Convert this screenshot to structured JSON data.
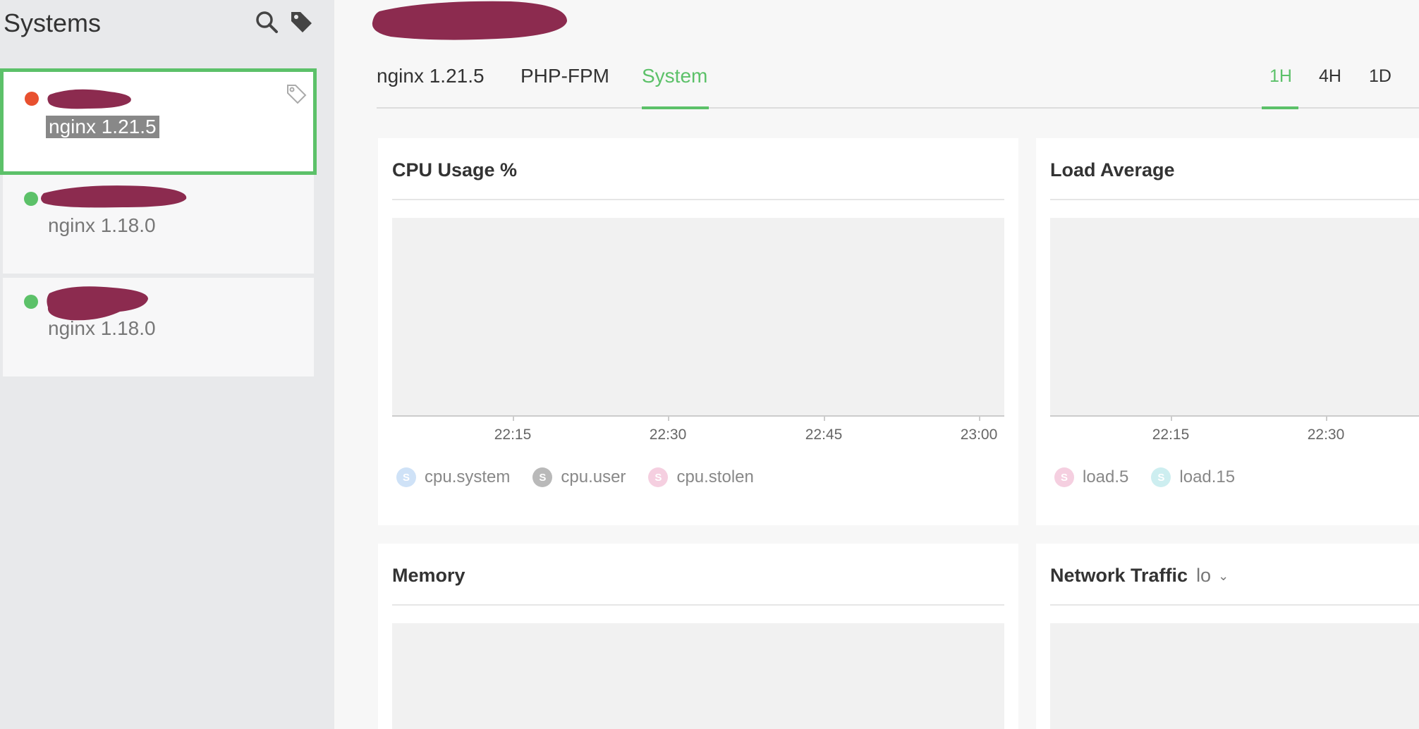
{
  "sidebar": {
    "title": "Systems",
    "systems": [
      {
        "version": "nginx 1.21.5",
        "status": "down",
        "status_color": "#e8502f",
        "selected": true
      },
      {
        "version": "nginx 1.18.0",
        "status": "up",
        "status_color": "#5cc169",
        "selected": false
      },
      {
        "version": "nginx 1.18.0",
        "status": "up",
        "status_color": "#5cc169",
        "selected": false
      }
    ]
  },
  "tabs": [
    {
      "label": "nginx 1.21.5",
      "active": false
    },
    {
      "label": "PHP-FPM",
      "active": false
    },
    {
      "label": "System",
      "active": true
    }
  ],
  "time_ranges": [
    {
      "label": "1H",
      "active": true
    },
    {
      "label": "4H",
      "active": false
    },
    {
      "label": "1D",
      "active": false
    }
  ],
  "cards": {
    "cpu": {
      "title": "CPU Usage %",
      "x_ticks": [
        "22:15",
        "22:30",
        "22:45",
        "23:00"
      ],
      "legend": [
        {
          "label": "cpu.system",
          "color": "#cfe2f7"
        },
        {
          "label": "cpu.user",
          "color": "#b9b9b9"
        },
        {
          "label": "cpu.stolen",
          "color": "#f5cfe0"
        }
      ]
    },
    "load": {
      "title": "Load Average",
      "x_ticks": [
        "22:15",
        "22:30"
      ],
      "legend": [
        {
          "label": "load.5",
          "color": "#f5cfe0"
        },
        {
          "label": "load.15",
          "color": "#cdeef0"
        }
      ]
    },
    "memory": {
      "title": "Memory"
    },
    "network": {
      "title": "Network Traffic",
      "interface": "lo"
    }
  },
  "colors": {
    "accent": "#5cc169",
    "redaction": "#8c2b4f"
  },
  "legend_icon_letter": "S"
}
